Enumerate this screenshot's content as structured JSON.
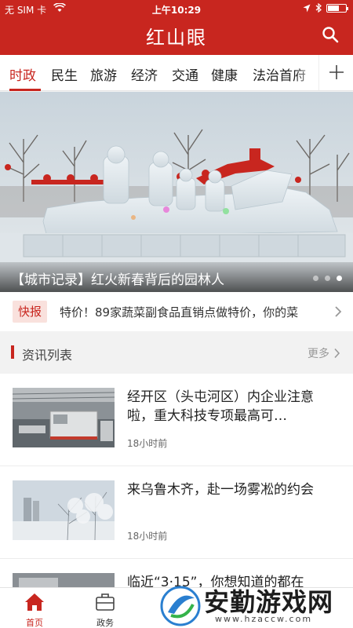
{
  "status_bar": {
    "carrier": "无 SIM 卡",
    "time": "上午10:29"
  },
  "header": {
    "app_title": "红山眼"
  },
  "tabs": [
    {
      "label": "时政",
      "active": true
    },
    {
      "label": "民生"
    },
    {
      "label": "旅游"
    },
    {
      "label": "经济"
    },
    {
      "label": "交通"
    },
    {
      "label": "健康"
    },
    {
      "label": "法治首府"
    }
  ],
  "banner": {
    "caption": "【城市记录】红火新春背后的园林人",
    "slide_count": 3,
    "active_slide": 3
  },
  "ticker": {
    "badge": "快报",
    "text": "特价！89家蔬菜副食品直销点做特价，你的菜"
  },
  "section": {
    "title": "资讯列表",
    "more": "更多"
  },
  "news": [
    {
      "title": "经开区（头屯河区）内企业注意啦，重大科技专项最高可…",
      "time": "18小时前"
    },
    {
      "title": "来乌鲁木齐，赴一场雾凇的约会",
      "time": "18小时前"
    },
    {
      "title": "临近“3·15”，你想知道的都在",
      "time": ""
    }
  ],
  "bottom_nav": [
    {
      "label": "首页",
      "icon": "home-icon",
      "active": true
    },
    {
      "label": "政务",
      "icon": "briefcase-icon"
    }
  ],
  "watermark": {
    "text": "安勤游戏网",
    "url": "www.hzaccw.com"
  },
  "colors": {
    "brand_red": "#c8261f",
    "badge_bg": "#f9e1dd"
  }
}
